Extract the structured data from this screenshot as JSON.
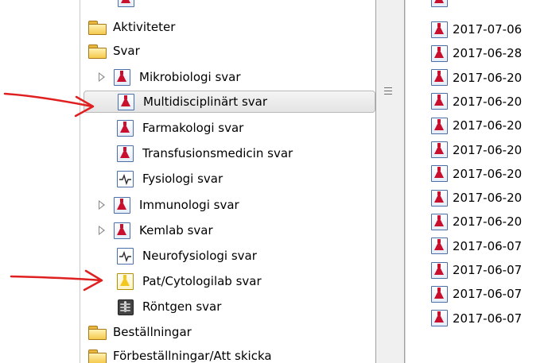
{
  "tree": {
    "items": [
      {
        "label": "Aktiviteter",
        "icon": "folder-icon",
        "level": 0,
        "expander": "none"
      },
      {
        "label": "Svar",
        "icon": "folder-icon",
        "level": 0,
        "expander": "none"
      },
      {
        "label": "Mikrobiologi svar",
        "icon": "lab-result-icon",
        "level": 1,
        "expander": "collapsed"
      },
      {
        "label": "Multidisciplinärt svar",
        "icon": "lab-result-icon",
        "level": 1,
        "expander": "none",
        "selected": true
      },
      {
        "label": "Farmakologi svar",
        "icon": "lab-result-icon",
        "level": 1,
        "expander": "none"
      },
      {
        "label": "Transfusionsmedicin svar",
        "icon": "lab-result-icon",
        "level": 1,
        "expander": "none"
      },
      {
        "label": "Fysiologi svar",
        "icon": "pulse-icon",
        "level": 1,
        "expander": "none"
      },
      {
        "label": "Immunologi svar",
        "icon": "lab-result-icon",
        "level": 1,
        "expander": "collapsed"
      },
      {
        "label": "Kemlab svar",
        "icon": "lab-result-icon",
        "level": 1,
        "expander": "collapsed"
      },
      {
        "label": "Neurofysiologi svar",
        "icon": "pulse-icon",
        "level": 1,
        "expander": "none"
      },
      {
        "label": "Pat/Cytologilab svar",
        "icon": "yellow-lab-icon",
        "level": 1,
        "expander": "none"
      },
      {
        "label": "Röntgen svar",
        "icon": "xray-icon",
        "level": 1,
        "expander": "none"
      },
      {
        "label": "Beställningar",
        "icon": "folder-icon",
        "level": 0,
        "expander": "none"
      },
      {
        "label": "Förbeställningar/Att skicka",
        "icon": "folder-icon",
        "level": 0,
        "expander": "none"
      }
    ]
  },
  "list": {
    "dates": [
      "2017-07-06",
      "2017-06-28",
      "2017-06-20",
      "2017-06-20",
      "2017-06-20",
      "2017-06-20",
      "2017-06-20",
      "2017-06-20",
      "2017-06-20",
      "2017-06-07",
      "2017-06-07",
      "2017-06-07",
      "2017-06-07"
    ]
  },
  "colors": {
    "arrow": "#e02020",
    "selection_border": "#b9b9b9",
    "lab_flask": "#c8102e"
  }
}
